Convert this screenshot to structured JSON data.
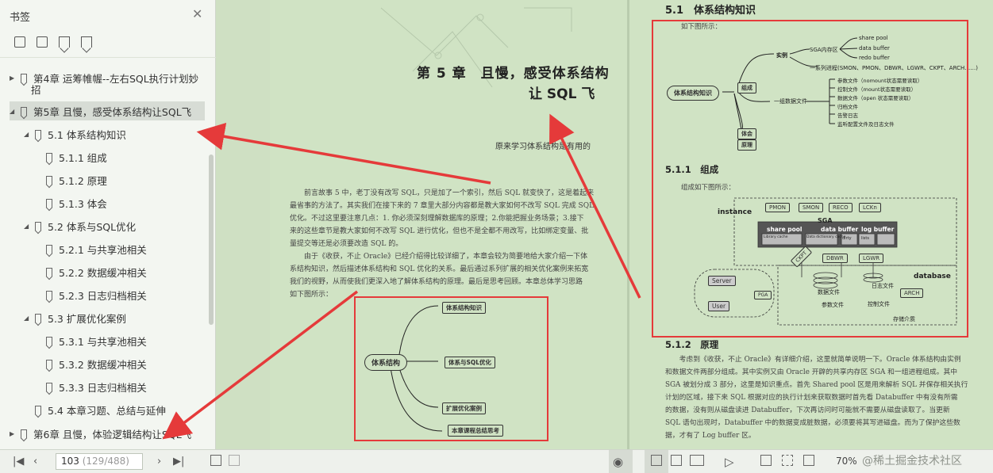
{
  "sidebar": {
    "title": "书签",
    "items": [
      {
        "label": "第4章 运筹帷幄--左右SQL执行计划妙",
        "label2": "招"
      },
      {
        "label": "第5章 且慢，感受体系结构让SQL飞"
      },
      {
        "label": "5.1 体系结构知识"
      },
      {
        "label": "5.1.1 组成"
      },
      {
        "label": "5.1.2 原理"
      },
      {
        "label": "5.1.3 体会"
      },
      {
        "label": "5.2 体系与SQL优化"
      },
      {
        "label": "5.2.1 与共享池相关"
      },
      {
        "label": "5.2.2 数据缓冲相关"
      },
      {
        "label": "5.2.3 日志归档相关"
      },
      {
        "label": "5.3 扩展优化案例"
      },
      {
        "label": "5.3.1 与共享池相关"
      },
      {
        "label": "5.3.2 数据缓冲相关"
      },
      {
        "label": "5.3.3 日志归档相关"
      },
      {
        "label": "5.4 本章习题、总结与延伸"
      },
      {
        "label": "第6章 且慢，体验逻辑结构让SQL飞"
      }
    ]
  },
  "left_page": {
    "chapter_line1": "第 5 章　且慢，感受体系结构",
    "chapter_line2": "让 SQL 飞",
    "quote": "原来学习体系结构是有用的",
    "para1": [
      "　　前言故事 5 中，老丁没有改写 SQL，只是加了一个索引，然后 SQL 就变快了，这是着起来",
      "最省事的方法了。其实我们在接下来的 7 章里大部分内容都是教大家如何不改写 SQL 完成 SQL",
      "优化。不过这里要注意几点：1. 你必须深刻理解数据库的原理；2.你能把握业务场景；3.接下",
      "来的这些章节是教大家如何不改写 SQL 进行优化，但也不是全都不用改写，比如绑定变量、批",
      "量提交等还是必须要改造 SQL 的。"
    ],
    "para2": [
      "　　由于《收获，不止 Oracle》已经介绍得比较详细了，本章会较为简要地给大家介绍一下体",
      "系结构知识，然后描述体系结构和 SQL 优化的关系。最后通过系列扩展的相关优化案例来拓宽",
      "我们的视野，从而使我们更深入地了解体系结构的原理。最后是思考回顾。本章总体学习思路",
      "如下图所示："
    ],
    "mindmap": {
      "root": "体系结构",
      "b1": "体系结构知识",
      "b2": "体系与SQL优化",
      "b3": "扩展优化案例",
      "b4": "本章课程总结思考"
    }
  },
  "right_page": {
    "section_title": "5.1　体系结构知识",
    "intro": "如下图所示：",
    "mm": {
      "root": "体系结构知识",
      "composition": "组成",
      "instance": "实例",
      "sga": "SGA内存区",
      "share_pool": "share pool",
      "data_buffer": "data buffer",
      "redo_buffer": "redo buffer",
      "processes": "一系列进程(SMON、PMON、DBWR、LGWR、CKPT、ARCH……)",
      "datafiles": "一组数据文件",
      "f1": "参数文件（nomount状态需要读取）",
      "f2": "控制文件（mount状态需要读取）",
      "f3": "数据文件（open 状态需要读取）",
      "f4": "归档文件",
      "f5": "告警日志",
      "f6": "监听配置文件及日志文件",
      "exp": "体会",
      "principle": "原理"
    },
    "s511": "5.1.1　组成",
    "s511_intro": "组成如下图所示：",
    "arch": {
      "instance": "instance",
      "pmon": "PMON",
      "smon": "SMON",
      "reco": "RECO",
      "lckn": "LCKn",
      "sga": "SGA",
      "share_pool": "share pool",
      "data_buffer": "data buffer",
      "log_buffer": "log buffer",
      "library_cache": "Library cache",
      "dict_cache": "Data dictionary cache",
      "dirty": "dirty",
      "lists": "lists",
      "ckpt": "CKPT",
      "dbwr": "DBWR",
      "lgwr": "LGWR",
      "server": "Server",
      "pga": "PGA",
      "user": "User",
      "database": "database",
      "datafile": "数据文件",
      "paramfile": "参数文件",
      "logfile": "日志文件",
      "ctlfile": "控制文件",
      "arch": "ARCH",
      "storage": "存储介质"
    },
    "s512": "5.1.2　原理",
    "para": [
      "　　考虑到《收获，不止 Oracle》有详细介绍，这里就简单说明一下。Oracle 体系结构由实例",
      "和数据文件两部分组成。其中实例又由 Oracle 开辟的共享内存区 SGA 和一组进程组成。其中",
      "SGA 被划分成 3 部分，这里是知识重点。首先 Shared pool 区是用来解析 SQL 并保存相关执行",
      "计划的区域，接下来 SQL 根据对应的执行计划来获取数据时首先看 Databuffer 中有没有所需",
      "的数据，没有则从磁盘读进 Databuffer，下次再访问时可能就不需要从磁盘读取了。当更新",
      "SQL 语句出现时，Databuffer 中的数据变成脏数据，必须要将其写进磁盘。而为了保护这些数",
      "据，才有了 Log buffer 区。"
    ]
  },
  "toolbar": {
    "current_page": "103",
    "page_total": "(129/488)",
    "zoom": "70%"
  },
  "watermark": "@稀土掘金技术社区",
  "colors": {
    "annotation_red": "#e53a3a",
    "page_bg": "#d0e3c4"
  }
}
